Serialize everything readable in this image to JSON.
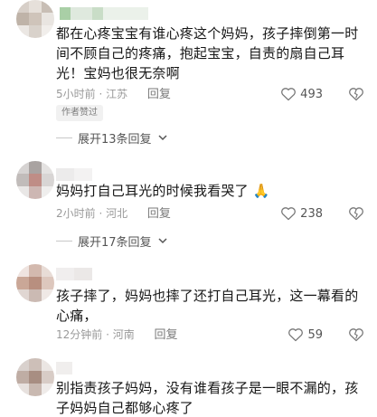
{
  "comments": [
    {
      "text": "都在心疼宝宝有谁心疼这个妈妈，孩子摔倒第一时间不顾自己的疼痛，抱起宝宝，自责的扇自己耳光！宝妈也很无奈啊",
      "time_location": "5小时前 · 江苏",
      "reply_label": "回复",
      "likes": "493",
      "badge": "作者赞过",
      "expand_label": "展开13条回复"
    },
    {
      "text": "妈妈打自己耳光的时候我看哭了",
      "emoji": "🙏",
      "time_location": "2小时前 · 河北",
      "reply_label": "回复",
      "likes": "238",
      "expand_label": "展开17条回复"
    },
    {
      "text": "孩子摔了，妈妈也摔了还打自己耳光，这一幕看的心痛，",
      "time_location": "12分钟前 · 河南",
      "reply_label": "回复",
      "likes": "59"
    },
    {
      "text": "别指责孩子妈妈，没有谁看孩子是一眼不漏的，孩子妈妈自己都够心疼了"
    }
  ],
  "colors": {
    "text": "#161616",
    "meta": "#9a9a9a",
    "badge_bg": "#f1f1f1"
  },
  "icons": {
    "like": "heart-outline-icon",
    "dislike": "broken-heart-icon",
    "expand": "chevron-down-icon"
  }
}
